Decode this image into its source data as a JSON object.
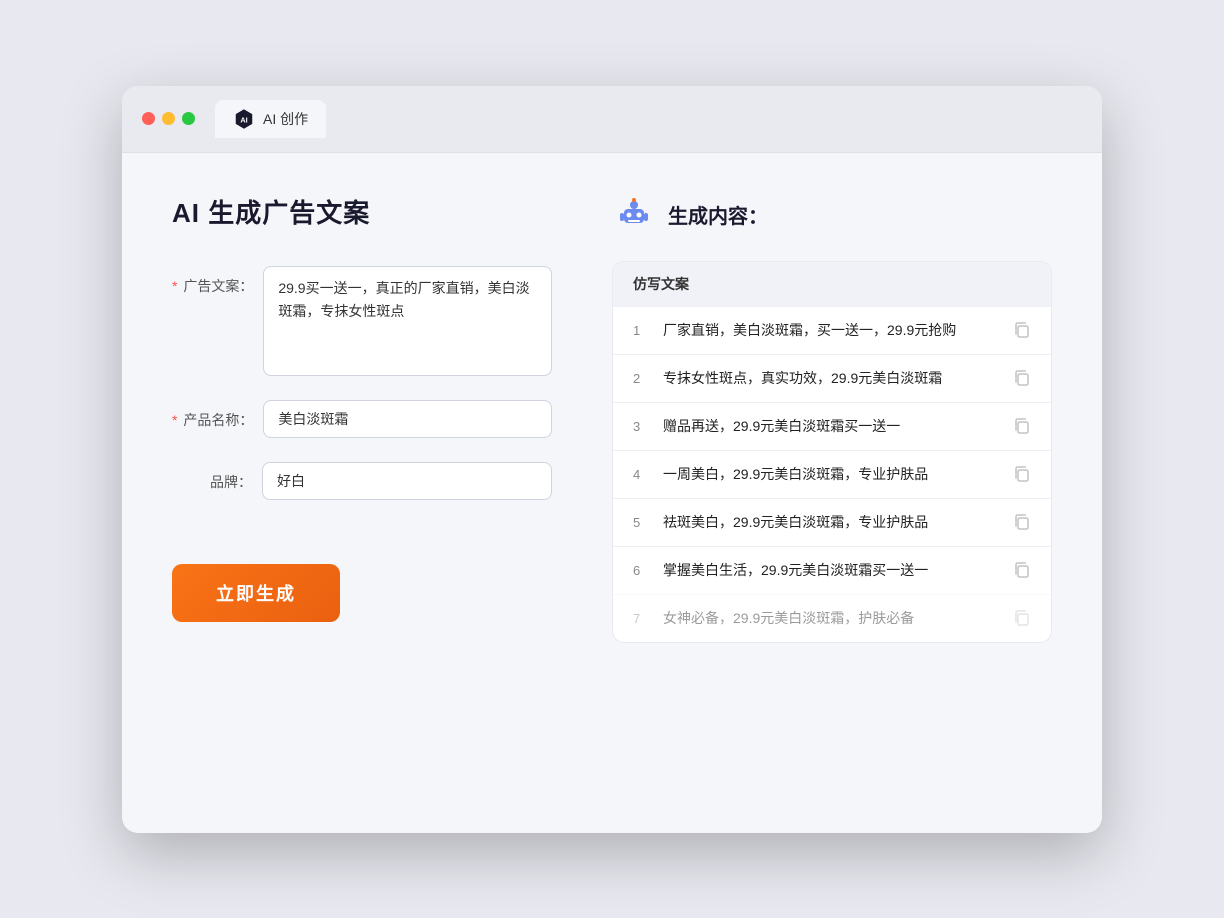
{
  "window": {
    "tab_title": "AI 创作"
  },
  "left": {
    "page_title": "AI 生成广告文案",
    "fields": [
      {
        "id": "ad_copy",
        "label": "广告文案：",
        "required": true,
        "type": "textarea",
        "value": "29.9买一送一，真正的厂家直销，美白淡斑霜，专抹女性斑点"
      },
      {
        "id": "product_name",
        "label": "产品名称：",
        "required": true,
        "type": "input",
        "value": "美白淡斑霜"
      },
      {
        "id": "brand",
        "label": "品牌：",
        "required": false,
        "type": "input",
        "value": "好白"
      }
    ],
    "generate_button": "立即生成"
  },
  "right": {
    "section_title": "生成内容：",
    "table_header": "仿写文案",
    "results": [
      {
        "num": "1",
        "text": "厂家直销，美白淡斑霜，买一送一，29.9元抢购",
        "faded": false
      },
      {
        "num": "2",
        "text": "专抹女性斑点，真实功效，29.9元美白淡斑霜",
        "faded": false
      },
      {
        "num": "3",
        "text": "赠品再送，29.9元美白淡斑霜买一送一",
        "faded": false
      },
      {
        "num": "4",
        "text": "一周美白，29.9元美白淡斑霜，专业护肤品",
        "faded": false
      },
      {
        "num": "5",
        "text": "祛斑美白，29.9元美白淡斑霜，专业护肤品",
        "faded": false
      },
      {
        "num": "6",
        "text": "掌握美白生活，29.9元美白淡斑霜买一送一",
        "faded": false
      },
      {
        "num": "7",
        "text": "女神必备，29.9元美白淡斑霜，护肤必备",
        "faded": true
      }
    ]
  }
}
